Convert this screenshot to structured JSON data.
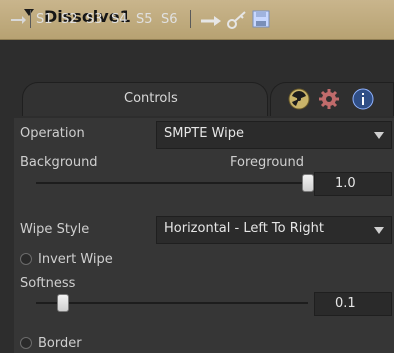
{
  "header": {
    "title": "Dissolve1"
  },
  "toolbar": {
    "source_buttons": [
      "S1",
      "S2",
      "S3",
      "S4",
      "S5",
      "S6"
    ],
    "icons": [
      "pin-icon",
      "arrow-icon",
      "key-icon",
      "save-icon"
    ]
  },
  "tabs": {
    "controls": "Controls",
    "icons": [
      "radiation-icon",
      "gear-icon",
      "info-icon"
    ]
  },
  "operation": {
    "label": "Operation",
    "value": "SMPTE Wipe"
  },
  "mix": {
    "left_label": "Background",
    "right_label": "Foreground",
    "value": "1.0",
    "slider_fraction": 1.0
  },
  "wipe_style": {
    "label": "Wipe Style",
    "value": "Horizontal - Left To Right"
  },
  "invert_wipe": {
    "label": "Invert Wipe",
    "checked": false
  },
  "softness": {
    "label": "Softness",
    "value": "0.1",
    "slider_fraction": 0.1
  },
  "border": {
    "label": "Border",
    "checked": false
  },
  "colors": {
    "header_bg": "#c4b083",
    "panel_bg": "#363636",
    "window_bg": "#2d2d2d",
    "slider_thumb": "#e6e6e6"
  }
}
